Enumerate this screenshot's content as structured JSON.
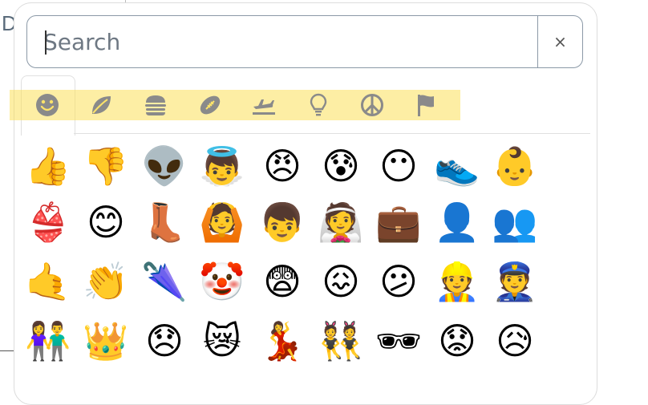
{
  "background": {
    "letter": "D"
  },
  "search": {
    "placeholder": "Search",
    "value": "",
    "clear_label": "×"
  },
  "categories": [
    {
      "name": "smileys",
      "icon": "smiley-face-icon"
    },
    {
      "name": "nature",
      "icon": "leaf-icon"
    },
    {
      "name": "food",
      "icon": "burger-icon"
    },
    {
      "name": "activity",
      "icon": "football-icon"
    },
    {
      "name": "travel",
      "icon": "airplane-icon"
    },
    {
      "name": "objects",
      "icon": "lightbulb-icon"
    },
    {
      "name": "symbols",
      "icon": "peace-sign-icon"
    },
    {
      "name": "flags",
      "icon": "flag-icon"
    }
  ],
  "colors": {
    "category_icon": "#8a8a8a",
    "highlight": "#fce05a"
  },
  "emojis": [
    [
      "👍",
      "👎",
      "👽",
      "👼",
      "😠",
      "😰",
      "😶",
      "👟",
      "👶"
    ],
    [
      "👙",
      "😊",
      "👢",
      "🙆",
      "👦",
      "👰",
      "💼",
      "👤",
      "👥"
    ],
    [
      "🤙",
      "👏",
      "🌂",
      "🤡",
      "😨",
      "😖",
      "😕",
      "👷",
      "👮"
    ],
    [
      "👫",
      "👑",
      "😞",
      "😿",
      "💃",
      "👯",
      "🕶",
      "😟",
      "😥"
    ]
  ]
}
